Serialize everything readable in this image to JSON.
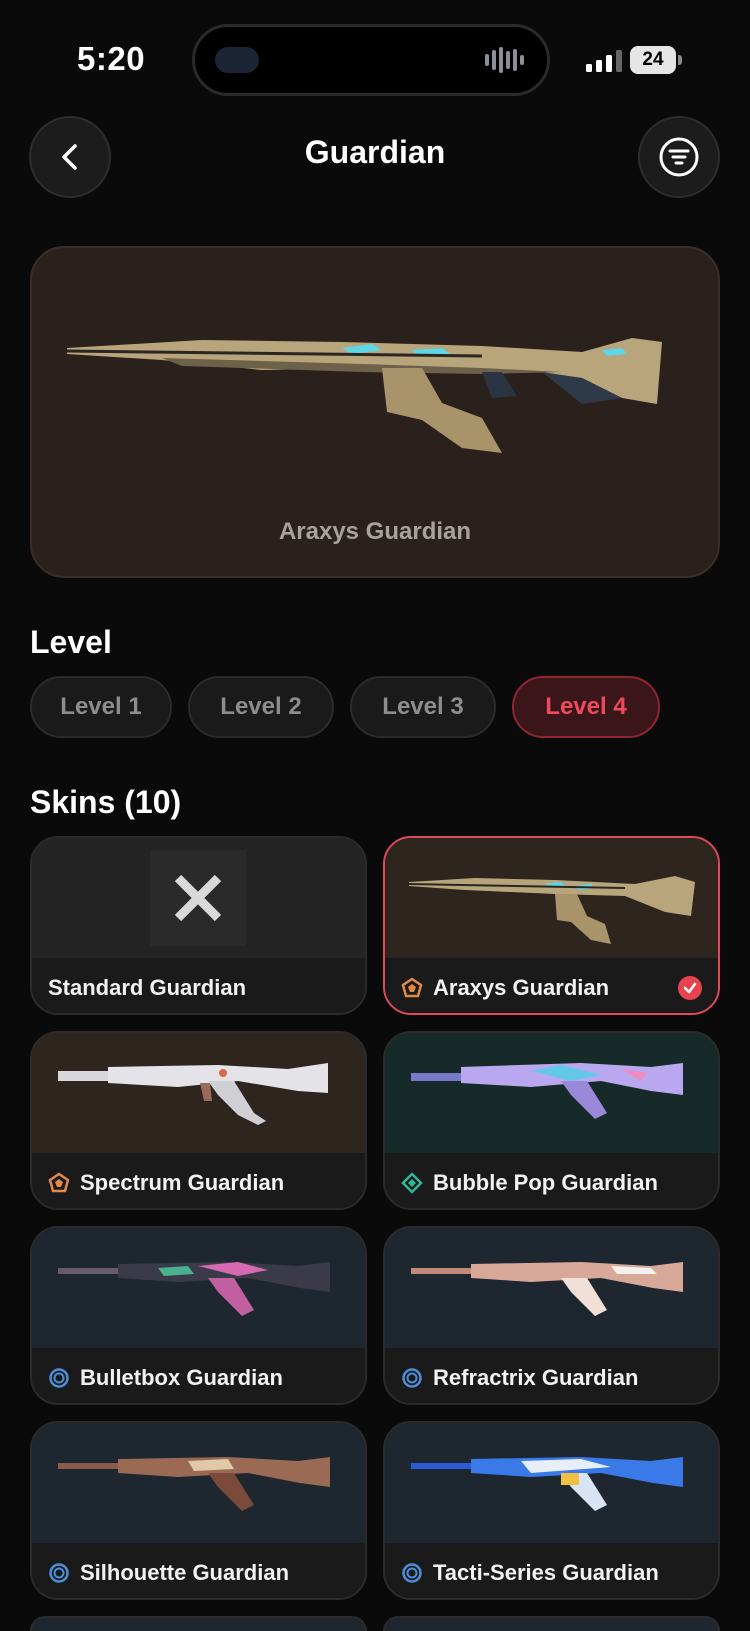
{
  "status": {
    "time": "5:20",
    "battery": "24"
  },
  "header": {
    "title": "Guardian",
    "back_icon": "chevron-left-icon",
    "filter_icon": "filter-icon"
  },
  "hero": {
    "name": "Araxys Guardian"
  },
  "level": {
    "title": "Level",
    "options": [
      "Level 1",
      "Level 2",
      "Level 3",
      "Level 4"
    ],
    "selected": "Level 4"
  },
  "skins": {
    "title": "Skins (10)",
    "items": [
      {
        "name": "Standard Guardian",
        "tier": "none",
        "bg": "#242424"
      },
      {
        "name": "Araxys Guardian",
        "tier": "exclusive",
        "bg": "#2f251f",
        "selected": true
      },
      {
        "name": "Spectrum Guardian",
        "tier": "exclusive",
        "bg": "#2f251f"
      },
      {
        "name": "Bubble Pop Guardian",
        "tier": "premium",
        "bg": "#172a2a"
      },
      {
        "name": "Bulletbox Guardian",
        "tier": "deluxe",
        "bg": "#1e2630"
      },
      {
        "name": "Refractrix Guardian",
        "tier": "deluxe",
        "bg": "#1e2630"
      },
      {
        "name": "Silhouette Guardian",
        "tier": "deluxe",
        "bg": "#1e2630"
      },
      {
        "name": "Tacti-Series Guardian",
        "tier": "deluxe",
        "bg": "#1e2630"
      }
    ]
  },
  "colors": {
    "accent": "#e8434f",
    "exclusive": "#e08a4a",
    "premium": "#2fb89a",
    "deluxe": "#4a8fd8"
  }
}
